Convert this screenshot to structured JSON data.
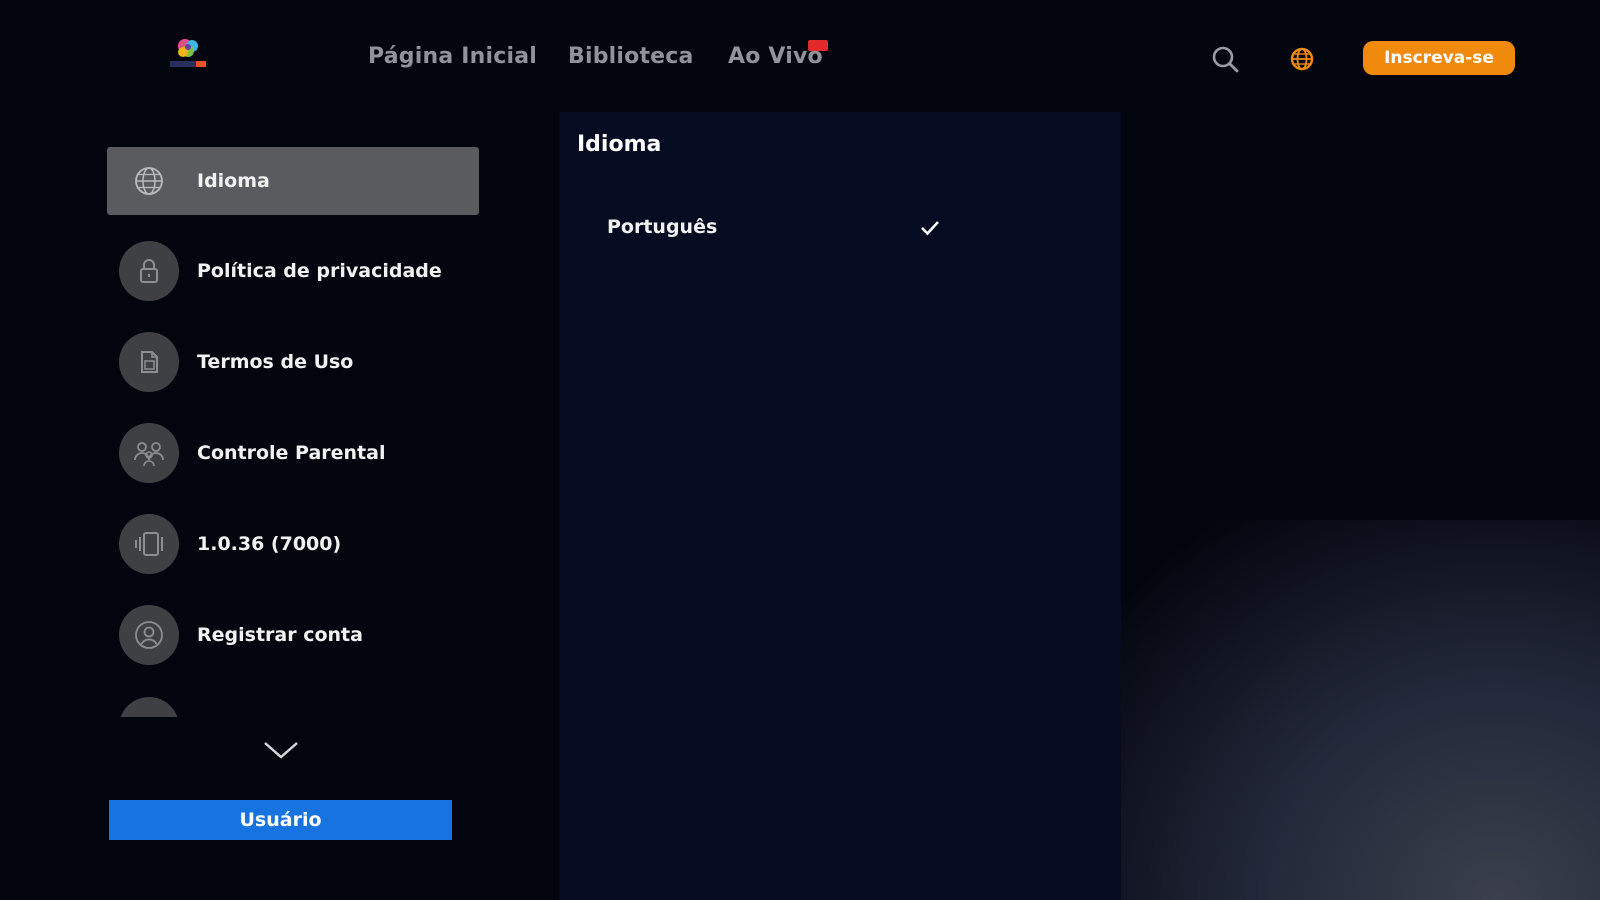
{
  "header": {
    "nav": [
      {
        "label": "Página Inicial"
      },
      {
        "label": "Biblioteca"
      },
      {
        "label": "Ao Vivo"
      }
    ],
    "subscribe_label": "Inscreva-se",
    "accent_color": "#f08a0c"
  },
  "sidebar": {
    "items": [
      {
        "label": "Idioma",
        "icon": "globe-icon",
        "active": true
      },
      {
        "label": "Política de privacidade",
        "icon": "lock-icon"
      },
      {
        "label": "Termos de Uso",
        "icon": "document-icon"
      },
      {
        "label": "Controle Parental",
        "icon": "people-icon"
      },
      {
        "label": "1.0.36 (7000)",
        "icon": "device-icon"
      },
      {
        "label": "Registrar conta",
        "icon": "user-icon"
      }
    ],
    "user_button_label": "Usuário",
    "user_button_color": "#1673e0"
  },
  "panel": {
    "title": "Idioma",
    "options": [
      {
        "label": "Português",
        "selected": true
      }
    ]
  }
}
